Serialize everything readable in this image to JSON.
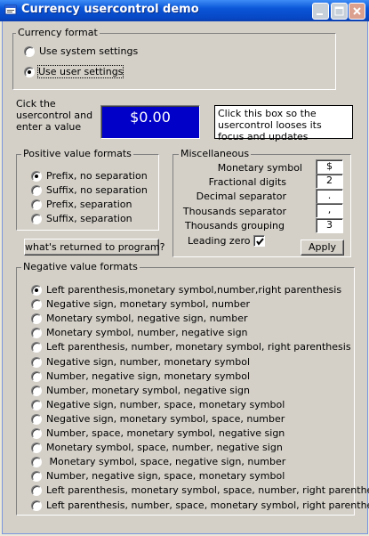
{
  "window": {
    "title": "Currency usercontrol demo"
  },
  "currency_format": {
    "group_label": "Currency format",
    "options": [
      "Use system settings",
      "Use user settings"
    ],
    "selected_index": 1
  },
  "usercontrol": {
    "prompt": "Cick the usercontrol and enter a value",
    "value": "$0.00",
    "hint": "Click this box so the usercontrol looses its focus and updates"
  },
  "positive_formats": {
    "group_label": "Positive value formats",
    "options": [
      "Prefix, no separation",
      "Suffix, no separation",
      "Prefix, separation",
      "Suffix, separation"
    ],
    "selected_index": 0
  },
  "returned_button": "what's  returned to program?",
  "misc": {
    "group_label": "Miscellaneous",
    "fields": [
      {
        "label": "Monetary symbol",
        "value": "$"
      },
      {
        "label": "Fractional digits",
        "value": "2"
      },
      {
        "label": "Decimal separator",
        "value": "."
      },
      {
        "label": "Thousands separator",
        "value": ","
      },
      {
        "label": "Thousands grouping",
        "value": "3"
      }
    ],
    "leading_zero_label": "Leading zero",
    "leading_zero_checked": true,
    "apply_label": "Apply"
  },
  "negative_formats": {
    "group_label": "Negative value formats",
    "options": [
      "Left parenthesis,monetary symbol,number,right parenthesis",
      "Negative sign, monetary symbol, number",
      "Monetary symbol, negative sign, number",
      "Monetary symbol, number, negative sign",
      "Left parenthesis, number, monetary symbol, right parenthesis",
      "Negative sign, number, monetary symbol",
      "Number, negative sign, monetary symbol",
      "Number, monetary symbol, negative sign",
      "Negative sign, number, space, monetary symbol",
      "Negative sign, monetary symbol, space, number",
      "Number, space, monetary symbol, negative sign",
      "Monetary symbol, space, number, negative sign",
      " Monetary symbol, space, negative sign, number",
      "Number, negative sign, space, monetary symbol",
      "Left parenthesis, monetary symbol, space, number, right parenthesis",
      "Left parenthesis, number, space, monetary symbol, right parenthesis"
    ],
    "selected_index": 0
  }
}
